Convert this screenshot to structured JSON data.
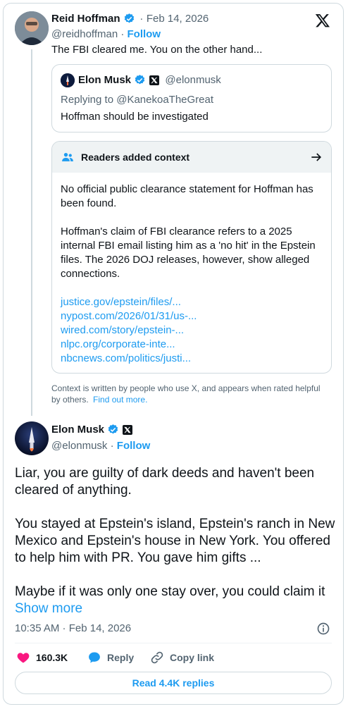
{
  "tweet1": {
    "display_name": "Reid Hoffman",
    "dot": "·",
    "date": "Feb 14, 2026",
    "handle": "@reidhoffman",
    "follow": "Follow",
    "text": "The FBI cleared me. You on the other hand..."
  },
  "quoted": {
    "display_name": "Elon Musk",
    "handle": "@elonmusk",
    "replying_to": "Replying to @KanekoaTheGreat",
    "text": "Hoffman should be investigated"
  },
  "context_note": {
    "title": "Readers added context",
    "para1": "No official public clearance statement for Hoffman has been found.",
    "para2": "Hoffman's claim of FBI clearance refers to a 2025 internal FBI email listing him as a 'no hit' in the Epstein files. The 2026 DOJ releases, however, show alleged connections.",
    "links": [
      "justice.gov/epstein/files/...",
      "nypost.com/2026/01/31/us-...",
      "wired.com/story/epstein-...",
      "nlpc.org/corporate-inte...",
      "nbcnews.com/politics/justi..."
    ],
    "footer": "Context is written by people who use X, and appears when rated helpful by others.",
    "find_out_more": "Find out more."
  },
  "tweet2": {
    "display_name": "Elon Musk",
    "handle": "@elonmusk",
    "dot": "·",
    "follow": "Follow",
    "para1": "Liar, you are guilty of dark deeds and haven't been cleared of anything.",
    "para2": "You stayed at Epstein's island, Epstein's ranch in New Mexico and Epstein's house in New York. You offered to help him with PR. You gave him gifts ...",
    "para3": "Maybe if it was only one stay over, you could claim it",
    "show_more": "Show more",
    "timestamp": "10:35 AM · Feb 14, 2026"
  },
  "actions": {
    "likes": "160.3K",
    "reply": "Reply",
    "copy_link": "Copy link",
    "read_replies": "Read 4.4K replies"
  },
  "colors": {
    "accent": "#1d9bf0",
    "like": "#f91880",
    "text": "#0f1419",
    "muted": "#536471"
  },
  "icons": [
    "x-logo-icon",
    "verified-icon",
    "x-affiliate-icon",
    "people-icon",
    "arrow-right-icon",
    "info-icon",
    "heart-icon",
    "reply-icon",
    "link-icon"
  ]
}
